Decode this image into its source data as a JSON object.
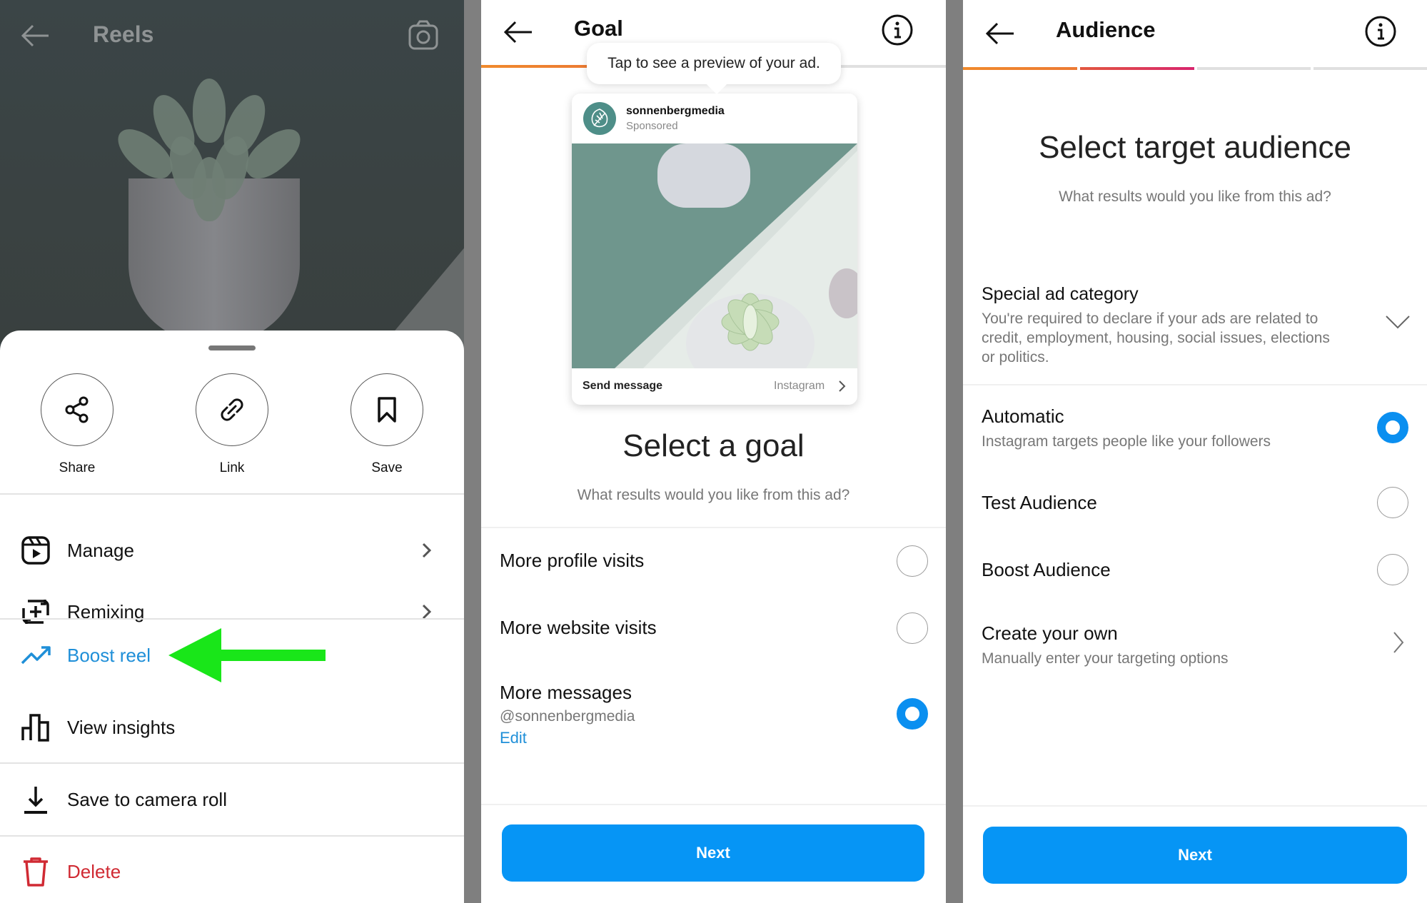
{
  "panels": {
    "reels_menu": {
      "header": {
        "title": "Reels",
        "back_icon": "arrow-left-icon",
        "camera_icon": "camera-icon"
      },
      "quick_actions": [
        {
          "label": "Share",
          "icon": "share-icon"
        },
        {
          "label": "Link",
          "icon": "link-icon"
        },
        {
          "label": "Save",
          "icon": "bookmark-icon"
        }
      ],
      "menu_items": [
        {
          "label": "Manage",
          "icon": "reels-icon",
          "has_chevron": true
        },
        {
          "label": "Remixing",
          "icon": "remix-icon",
          "has_chevron": true
        },
        {
          "label": "Boost reel",
          "icon": "trending-up-icon",
          "highlighted": true
        },
        {
          "label": "View insights",
          "icon": "bar-chart-icon"
        },
        {
          "label": "Save to camera roll",
          "icon": "download-icon"
        },
        {
          "label": "Delete",
          "icon": "trash-icon",
          "destructive": true
        }
      ],
      "annotation": "green-arrow-pointing-left"
    },
    "goal": {
      "header": {
        "title": "Goal",
        "back_icon": "arrow-left-icon",
        "info_icon": "info-icon"
      },
      "progress": {
        "steps_total": 4,
        "steps_done": 1
      },
      "tooltip": "Tap to see a preview of your ad.",
      "preview_card": {
        "username": "sonnenbergmedia",
        "sponsored": "Sponsored",
        "cta": "Send message",
        "source": "Instagram"
      },
      "title": "Select a goal",
      "subtitle": "What results would you like from this ad?",
      "options": [
        {
          "label": "More profile visits",
          "selected": false
        },
        {
          "label": "More website visits",
          "selected": false
        },
        {
          "label": "More messages",
          "handle": "@sonnenbergmedia",
          "edit": "Edit",
          "selected": true
        }
      ],
      "next_label": "Next"
    },
    "audience": {
      "header": {
        "title": "Audience",
        "back_icon": "arrow-left-icon",
        "info_icon": "info-icon"
      },
      "progress": {
        "steps_total": 4,
        "steps_done": 2
      },
      "title": "Select target audience",
      "subtitle": "What results would you like from this ad?",
      "special_category": {
        "label": "Special ad category",
        "description": "You're required to declare if your ads are related to credit, employment, housing, social issues, elections or politics."
      },
      "options": [
        {
          "label": "Automatic",
          "sub": "Instagram targets people like your followers",
          "selected": true
        },
        {
          "label": "Test Audience",
          "selected": false
        },
        {
          "label": "Boost Audience",
          "selected": false
        }
      ],
      "create_own": {
        "label": "Create your own",
        "sub": "Manually enter your targeting options"
      },
      "next_label": "Next"
    }
  },
  "colors": {
    "accent_blue": "#0695f5",
    "link_blue": "#1f8fd8",
    "delete_red": "#d02a33",
    "arrow_green": "#19e619",
    "progress_orange": "#f08a2c",
    "progress_pink": "#d8256e"
  }
}
